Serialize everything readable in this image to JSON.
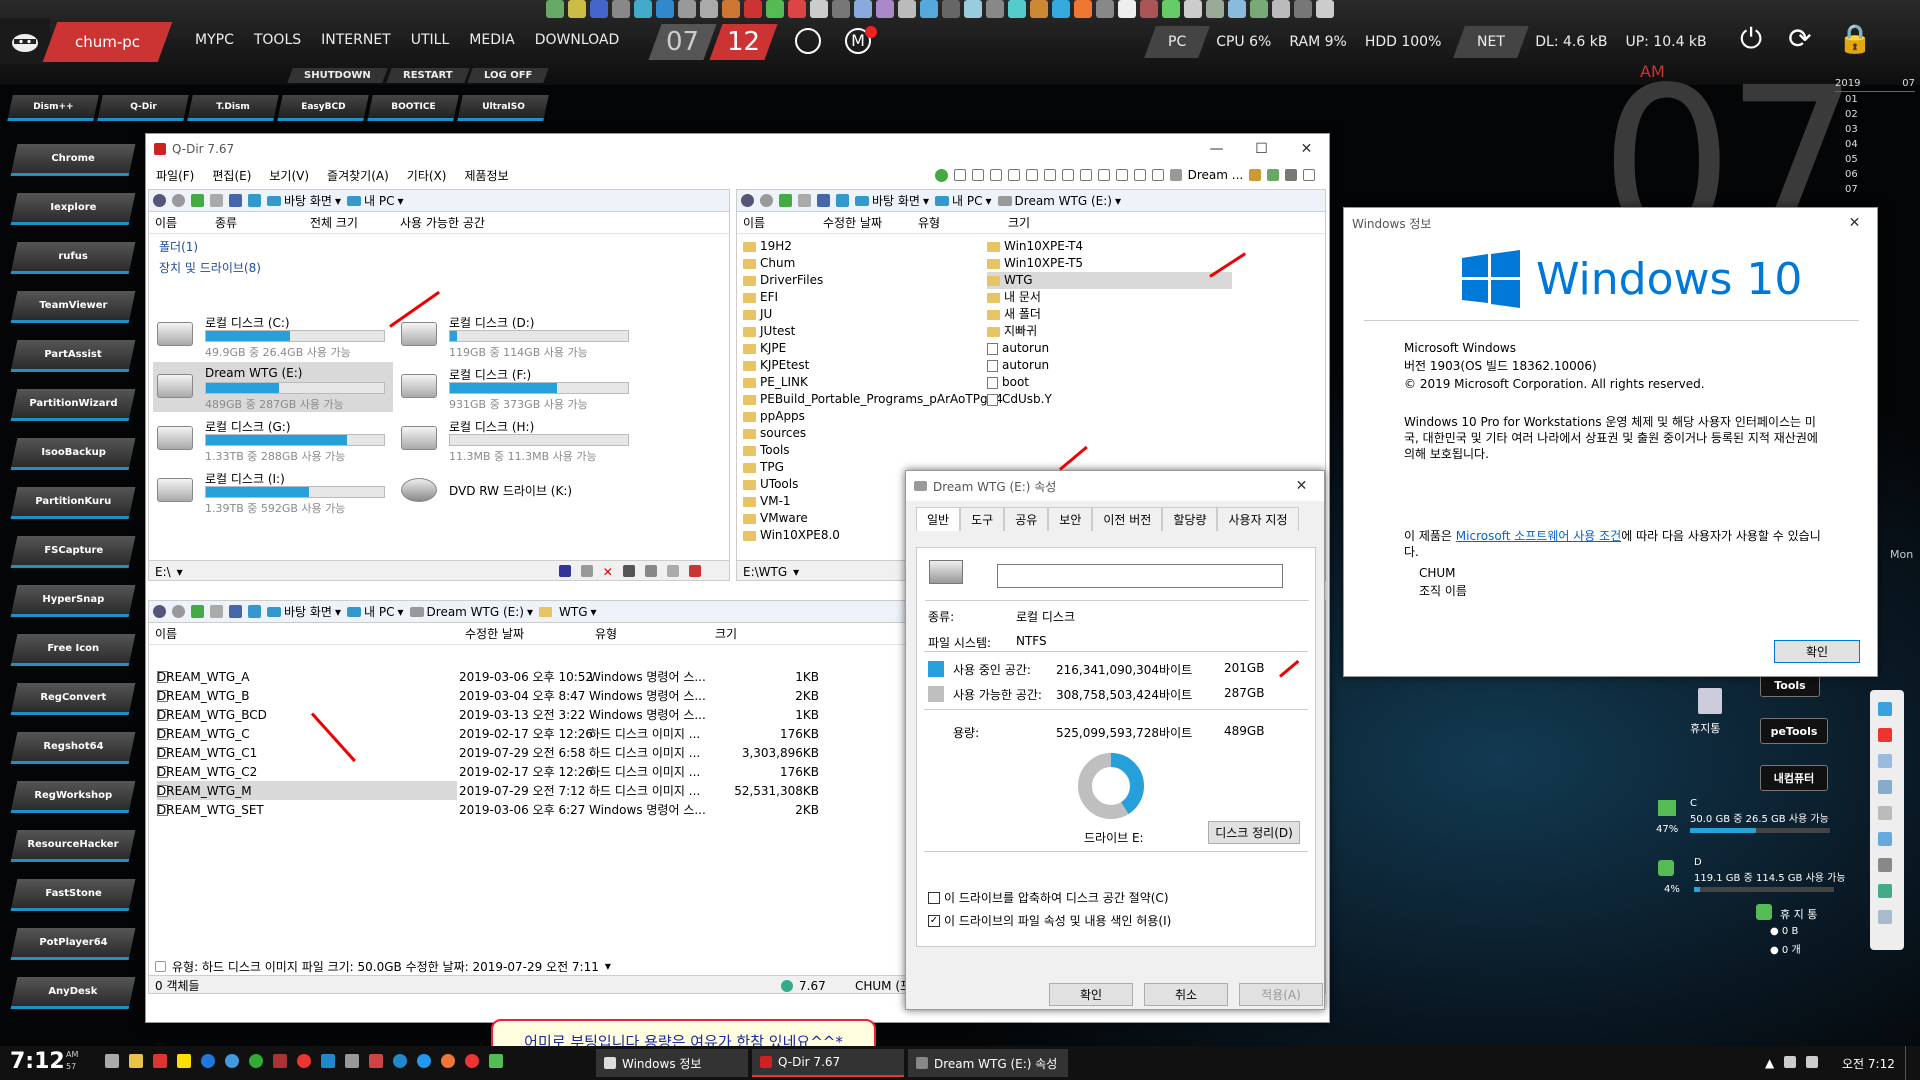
{
  "topbar": {
    "pc_name": "chum-pc",
    "menu": [
      "MYPC",
      "TOOLS",
      "INTERNET",
      "UTILL",
      "MEDIA",
      "DOWNLOAD"
    ],
    "month": "07",
    "day": "12",
    "pc_label": "PC",
    "cpu": "CPU  6%",
    "ram": "RAM  9%",
    "hdd": "HDD  100%",
    "net_label": "NET",
    "dl": "DL: 4.6 kB",
    "up": "UP: 10.4 kB",
    "power_icons": [
      "⏻",
      "⟳",
      "🔒"
    ]
  },
  "subbar": [
    "SHUTDOWN",
    "RESTART",
    "LOG OFF"
  ],
  "toolrow": [
    "Dism++",
    "Q-Dir",
    "T.Dism",
    "EasyBCD",
    "BOOTICE",
    "UltraISO"
  ],
  "sidebar": [
    "Chrome",
    "Iexplore",
    "rufus",
    "TeamViewer",
    "PartAssist",
    "PartitionWizard",
    "IsooBackup",
    "PartitionKuru",
    "FSCapture",
    "HyperSnap",
    "Free  Icon",
    "RegConvert",
    "Regshot64",
    "RegWorkshop",
    "ResourceHacker",
    "FastStone",
    "PotPlayer64",
    "AnyDesk"
  ],
  "clock": {
    "big": "07",
    "ampm": "AM",
    "year": "2019",
    "month": "07",
    "days": [
      "01",
      "02",
      "03",
      "04",
      "05",
      "06",
      "07"
    ],
    "weekday": "Mon"
  },
  "qdir": {
    "title": "Q-Dir 7.67",
    "menu": [
      "파일(F)",
      "편집(E)",
      "보기(V)",
      "즐겨찾기(A)",
      "기타(X)",
      "제품정보"
    ],
    "tl": {
      "nav": [
        "바탕 화면",
        "내 PC"
      ],
      "cols": [
        "이름",
        "종류",
        "전체 크기",
        "사용 가능한 공간"
      ],
      "group_folders": "폴더(1)",
      "group_drives": "장치 및 드라이브(8)",
      "drives": [
        {
          "name": "로컬 디스크 (C:)",
          "info": "49.9GB 중 26.4GB 사용 가능",
          "fill": 0.47
        },
        {
          "name": "로컬 디스크 (D:)",
          "info": "119GB 중 114GB 사용 가능",
          "fill": 0.04
        },
        {
          "name": "Dream WTG (E:)",
          "info": "489GB 중 287GB 사용 가능",
          "fill": 0.41
        },
        {
          "name": "로컬 디스크 (F:)",
          "info": "931GB 중 373GB 사용 가능",
          "fill": 0.6
        },
        {
          "name": "로컬 디스크 (G:)",
          "info": "1.33TB 중 288GB 사용 가능",
          "fill": 0.79
        },
        {
          "name": "로컬 디스크 (H:)",
          "info": "11.3MB 중 11.3MB 사용 가능",
          "fill": 0.0
        },
        {
          "name": "로컬 디스크 (I:)",
          "info": "1.39TB 중 592GB 사용 가능",
          "fill": 0.58
        }
      ],
      "dvd": "DVD RW 드라이브 (K:)",
      "status": "E:\\"
    },
    "tr": {
      "nav": [
        "바탕 화면",
        "내 PC",
        "Dream WTG (E:)"
      ],
      "cols": [
        "이름",
        "수정한 날짜",
        "유형",
        "크기"
      ],
      "folders_left": [
        "19H2",
        "Chum",
        "DriverFiles",
        "EFI",
        "JU",
        "JUtest",
        "KJPE",
        "KJPEtest",
        "PE_LINK",
        "PEBuild_Portable_Programs_pArAoTPg34",
        "ppApps",
        "sources",
        "Tools",
        "TPG",
        "UTools",
        "VM-1",
        "VMware",
        "Win10XPE8.0"
      ],
      "folders_right": [
        "Win10XPE-T4",
        "Win10XPE-T5",
        "WTG",
        "내 문서",
        "새 폴더",
        "지빠귀"
      ],
      "files_right": [
        "autorun",
        "autorun",
        "boot",
        "CdUsb.Y"
      ],
      "toolbar_label": "Dream ...",
      "status": "E:\\WTG"
    },
    "bl": {
      "nav": [
        "바탕 화면",
        "내 PC",
        "Dream WTG (E:)",
        "WTG"
      ],
      "cols": [
        "이름",
        "수정한 날짜",
        "유형",
        "크기"
      ],
      "rows": [
        {
          "name": "DREAM_WTG_A",
          "date": "2019-03-06 오후 10:52",
          "type": "Windows 명령어 스...",
          "size": "1KB"
        },
        {
          "name": "DREAM_WTG_B",
          "date": "2019-03-04 오후 8:47",
          "type": "Windows 명령어 스...",
          "size": "2KB"
        },
        {
          "name": "DREAM_WTG_BCD",
          "date": "2019-03-13 오전 3:22",
          "type": "Windows 명령어 스...",
          "size": "1KB"
        },
        {
          "name": "DREAM_WTG_C",
          "date": "2019-02-17 오후 12:26",
          "type": "하드 디스크 이미지 ...",
          "size": "176KB"
        },
        {
          "name": "DREAM_WTG_C1",
          "date": "2019-07-29 오전 6:58",
          "type": "하드 디스크 이미지 ...",
          "size": "3,303,896KB"
        },
        {
          "name": "DREAM_WTG_C2",
          "date": "2019-02-17 오후 12:26",
          "type": "하드 디스크 이미지 ...",
          "size": "176KB"
        },
        {
          "name": "DREAM_WTG_M",
          "date": "2019-07-29 오전 7:12",
          "type": "하드 디스크 이미지 ...",
          "size": "52,531,308KB"
        },
        {
          "name": "DREAM_WTG_SET",
          "date": "2019-03-06 오후 6:27",
          "type": "Windows 명령어 스...",
          "size": "2KB"
        }
      ],
      "callout": "어미로 부팅입니다 용량은 여유가 한참 있네요^^*",
      "info": "유형: 하드 디스크 이미지 파일 크기: 50.0GB 수정한 날짜: 2019-07-29 오전 7:11",
      "status": "0 객체들",
      "status_ver": "7.67",
      "status_user": "CHUM (포터블/Unicode)"
    }
  },
  "props": {
    "title": "Dream WTG (E:) 속성",
    "tabs": [
      "일반",
      "도구",
      "공유",
      "보안",
      "이전 버전",
      "할당량",
      "사용자 지정"
    ],
    "type_label": "종류:",
    "type_value": "로컬 디스크",
    "fs_label": "파일 시스템:",
    "fs_value": "NTFS",
    "used_label": "사용 중인 공간:",
    "used_bytes": "216,341,090,304바이트",
    "used_gb": "201GB",
    "free_label": "사용 가능한 공간:",
    "free_bytes": "308,758,503,424바이트",
    "free_gb": "287GB",
    "cap_label": "용량:",
    "cap_bytes": "525,099,593,728바이트",
    "cap_gb": "489GB",
    "used_fraction": 0.41,
    "drive_label": "드라이브 E:",
    "cleanup": "디스크 정리(D)",
    "compress": "이 드라이브를 압축하여 디스크 공간 절약(C)",
    "index": "이 드라이브의 파일 속성 및 내용 색인 허용(I)",
    "ok": "확인",
    "cancel": "취소",
    "apply": "적용(A)",
    "used_color": "#26a0da",
    "free_color": "#bfbfbf"
  },
  "winver": {
    "title": "Windows 정보",
    "logo_text": "Windows 10",
    "line1": "Microsoft Windows",
    "line2": "버전 1903(OS 빌드 18362.10006)",
    "line3": "© 2019 Microsoft Corporation. All rights reserved.",
    "para1": "Windows 10 Pro for Workstations 운영 체제 및 해당 사용자 인터페이스는 미국, 대한민국 및 기타 여러 나라에서 상표권 및 출원 중이거나 등록된 지적 재산권에 의해 보호됩니다.",
    "license_pre": "이 제품은 ",
    "license_link": "Microsoft 소프트웨어 사용 조건",
    "license_post": "에 따라 다음 사용자가 사용할 수 있습니다.",
    "user": "CHUM",
    "org": "조직 이름",
    "ok": "확인"
  },
  "desktop": {
    "buttons": [
      "Tools",
      "peTools",
      "내컴퓨터"
    ],
    "recycle": "휴지통",
    "c_label": "C",
    "c_info": "50.0 GB 중  26.5 GB 사용 가능",
    "c_pct": "47%",
    "c_fill": 0.47,
    "d_label": "D",
    "d_info": "119.1 GB 중 114.5 GB 사용 가능",
    "d_pct": "4%",
    "d_fill": 0.04,
    "trash_title": "휴 지 통",
    "trash_size": "0 B",
    "trash_count": "0 개"
  },
  "taskbar": {
    "time": "7:12",
    "ampm": "AM",
    "sec": "57",
    "items": [
      "Windows 정보",
      "Q-Dir 7.67",
      "Dream WTG (E:) 속성"
    ],
    "clock_right": "오전 7:12"
  }
}
